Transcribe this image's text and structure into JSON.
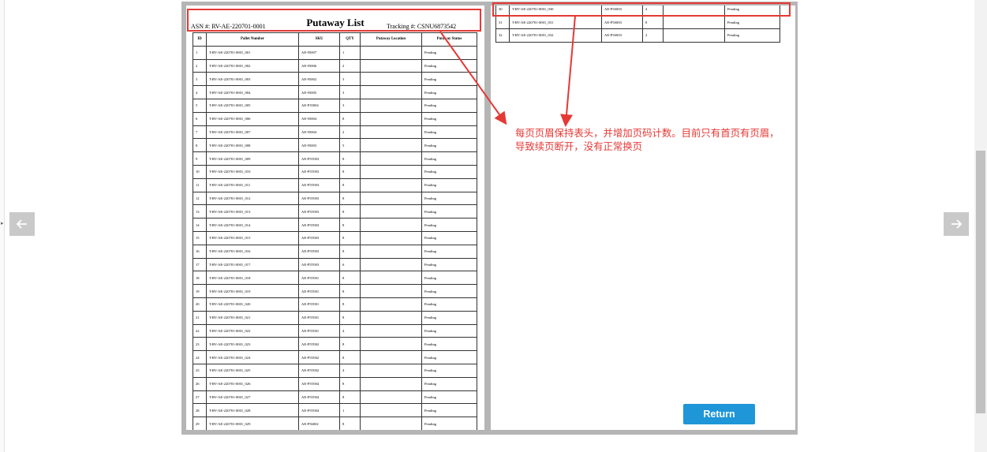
{
  "doc": {
    "title": "Putaway List",
    "asn": "ASN #:  RV-AE-220701-0001",
    "tracking": "Tracking #:  CSNU6873542"
  },
  "table": {
    "headers": [
      "ID",
      "Pallet Number",
      "SKU",
      "QTY",
      "Putaway Location",
      "Putaway Status"
    ],
    "rows_page1": [
      [
        "1",
        "T-RV-AE-220701-0001_001",
        "AE-95007",
        "1",
        "",
        "Pending"
      ],
      [
        "2",
        "T-RV-AE-220701-0001_002",
        "AE-95006",
        "2",
        "",
        "Pending"
      ],
      [
        "3",
        "T-RV-AE-220701-0001_003",
        "AE-95002",
        "3",
        "",
        "Pending"
      ],
      [
        "4",
        "T-RV-AE-220701-0001_004",
        "AE-95005",
        "3",
        "",
        "Pending"
      ],
      [
        "5",
        "T-RV-AE-220701-0001_005",
        "AE-P35004",
        "3",
        "",
        "Pending"
      ],
      [
        "6",
        "T-RV-AE-220701-0001_006",
        "AE-95004",
        "8",
        "",
        "Pending"
      ],
      [
        "7",
        "T-RV-AE-220701-0001_007",
        "AE-95004",
        "2",
        "",
        "Pending"
      ],
      [
        "8",
        "T-RV-AE-220701-0001_008",
        "AE-95003",
        "5",
        "",
        "Pending"
      ],
      [
        "9",
        "T-RV-AE-220701-0001_009",
        "AE-P5T003",
        "8",
        "",
        "Pending"
      ],
      [
        "10",
        "T-RV-AE-220701-0001_010",
        "AE-P5T003",
        "8",
        "",
        "Pending"
      ],
      [
        "11",
        "T-RV-AE-220701-0001_011",
        "AE-P5T003",
        "8",
        "",
        "Pending"
      ],
      [
        "12",
        "T-RV-AE-220701-0001_012",
        "AE-P5T003",
        "8",
        "",
        "Pending"
      ],
      [
        "13",
        "T-RV-AE-220701-0001_013",
        "AE-P5T003",
        "8",
        "",
        "Pending"
      ],
      [
        "14",
        "T-RV-AE-220701-0001_014",
        "AE-P5T003",
        "8",
        "",
        "Pending"
      ],
      [
        "15",
        "T-RV-AE-220701-0001_015",
        "AE-P5T003",
        "8",
        "",
        "Pending"
      ],
      [
        "16",
        "T-RV-AE-220701-0001_016",
        "AE-P5T003",
        "8",
        "",
        "Pending"
      ],
      [
        "17",
        "T-RV-AE-220701-0001_017",
        "AE-P5T003",
        "6",
        "",
        "Pending"
      ],
      [
        "18",
        "T-RV-AE-220701-0001_018",
        "AE-P5T001",
        "8",
        "",
        "Pending"
      ],
      [
        "19",
        "T-RV-AE-220701-0001_019",
        "AE-P5T001",
        "8",
        "",
        "Pending"
      ],
      [
        "20",
        "T-RV-AE-220701-0001_020",
        "AE-P5T001",
        "8",
        "",
        "Pending"
      ],
      [
        "21",
        "T-RV-AE-220701-0001_021",
        "AE-P5T001",
        "8",
        "",
        "Pending"
      ],
      [
        "22",
        "T-RV-AE-220701-0001_022",
        "AE-P5T001",
        "4",
        "",
        "Pending"
      ],
      [
        "23",
        "T-RV-AE-220701-0001_023",
        "AE-P5T002",
        "8",
        "",
        "Pending"
      ],
      [
        "24",
        "T-RV-AE-220701-0001_024",
        "AE-P5T002",
        "8",
        "",
        "Pending"
      ],
      [
        "25",
        "T-RV-AE-220701-0001_025",
        "AE-P5T002",
        "4",
        "",
        "Pending"
      ],
      [
        "26",
        "T-RV-AE-220701-0001_026",
        "AE-P5T004",
        "8",
        "",
        "Pending"
      ],
      [
        "27",
        "T-RV-AE-220701-0001_027",
        "AE-P5T004",
        "8",
        "",
        "Pending"
      ],
      [
        "28",
        "T-RV-AE-220701-0001_028",
        "AE-P5T004",
        "1",
        "",
        "Pending"
      ],
      [
        "29",
        "T-RV-AE-220701-0001_029",
        "AE-P56002",
        "8",
        "",
        "Pending"
      ]
    ],
    "rows_page2": [
      [
        "30",
        "T-RV-AE-220701-0001_030",
        "AE-P5S003",
        "4",
        "",
        "Pending"
      ],
      [
        "31",
        "T-RV-AE-220701-0001_031",
        "AE-P5S003",
        "8",
        "",
        "Pending"
      ],
      [
        "32",
        "T-RV-AE-220701-0001_032",
        "AE-P5S003",
        "2",
        "",
        "Pending"
      ]
    ]
  },
  "annotation": {
    "text": "每页页眉保持表头，并增加页码计数。目前只有首页有页眉，导致续页断开，没有正常换页",
    "color": "#e53935"
  },
  "return_button": {
    "label": "Return",
    "color": "#1e96d8"
  },
  "icons": {
    "prev": "arrow-left-icon",
    "next": "arrow-right-icon"
  }
}
